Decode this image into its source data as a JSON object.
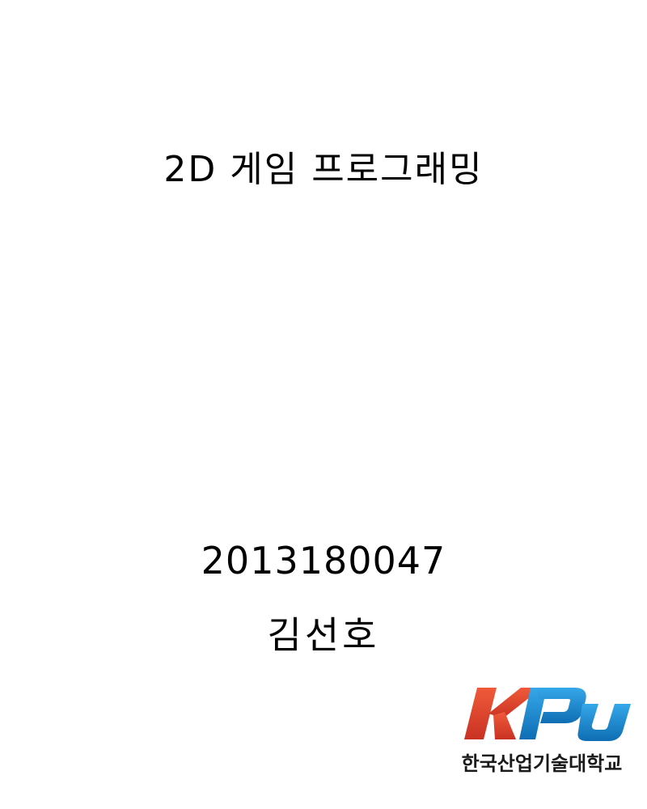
{
  "document": {
    "title": "2D 게임 프로그래밍",
    "student_id": "2013180047",
    "student_name": "김선호"
  },
  "logo": {
    "wordmark": "KPU",
    "caption": "한국산업기술대학교",
    "colors": {
      "k_red": "#e8432f",
      "k_red_dark": "#c93222",
      "pu_blue": "#1d8fd6",
      "pu_blue_dark": "#0f6db3"
    }
  }
}
